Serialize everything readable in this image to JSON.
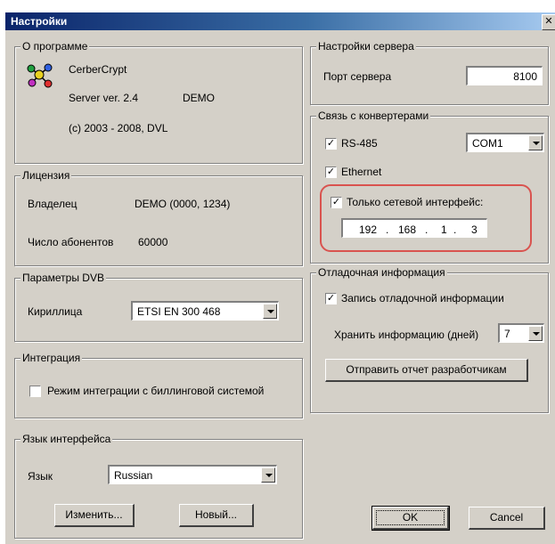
{
  "window": {
    "title": "Настройки",
    "close_glyph": "✕"
  },
  "about": {
    "legend": "О программе",
    "app_name": "CerberCrypt",
    "version": "Server ver. 2.4",
    "edition": "DEMO",
    "copyright": "(c) 2003 - 2008, DVL",
    "icon": "molecule-icon"
  },
  "license": {
    "legend": "Лицензия",
    "owner_label": "Владелец",
    "owner_value": "DEMO (0000, 1234)",
    "subscribers_label": "Число абонентов",
    "subscribers_value": "60000"
  },
  "dvb": {
    "legend": "Параметры DVB",
    "cyrillic_label": "Кириллица",
    "cyrillic_value": "ETSI EN 300 468"
  },
  "integration": {
    "legend": "Интеграция",
    "billing_label": "Режим интеграции с биллинговой системой",
    "billing_checked": false
  },
  "language": {
    "legend": "Язык интерфейса",
    "label": "Язык",
    "value": "Russian",
    "edit_button": "Изменить...",
    "new_button": "Новый..."
  },
  "server": {
    "legend": "Настройки сервера",
    "port_label": "Порт сервера",
    "port_value": "8100"
  },
  "converters": {
    "legend": "Связь с конвертерами",
    "rs485_label": "RS-485",
    "rs485_checked": true,
    "com_value": "COM1",
    "ethernet_label": "Ethernet",
    "ethernet_checked": true,
    "net_only_label": "Только сетевой интерфейс:",
    "net_only_checked": true,
    "ip": [
      "192",
      "168",
      "1",
      "3"
    ],
    "ip_dot": "."
  },
  "debug": {
    "legend": "Отладочная информация",
    "log_label": "Запись отладочной информации",
    "log_checked": true,
    "keep_label": "Хранить информацию (дней)",
    "keep_value": "7",
    "send_button": "Отправить отчет разработчикам"
  },
  "footer": {
    "ok_button": "OK",
    "cancel_button": "Cancel"
  },
  "colors": {
    "title_start": "#0a246a",
    "title_end": "#a6caf0",
    "highlight": "#d9534f",
    "face": "#d4d0c8"
  }
}
